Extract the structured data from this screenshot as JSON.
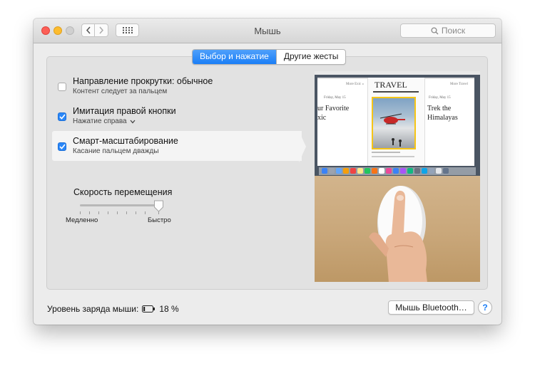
{
  "window": {
    "title": "Мышь"
  },
  "toolbar": {
    "search_placeholder": "Поиск",
    "back_icon": "chevron-left-icon",
    "forward_icon": "chevron-right-icon",
    "grid_icon": "grid-icon"
  },
  "tabs": [
    {
      "label": "Выбор и нажатие",
      "active": true
    },
    {
      "label": "Другие жесты",
      "active": false
    }
  ],
  "options": [
    {
      "title": "Направление прокрутки: обычное",
      "subtitle": "Контент следует за пальцем",
      "checked": false,
      "has_dropdown": false,
      "selected": false
    },
    {
      "title": "Имитация правой кнопки",
      "subtitle": "Нажатие справа",
      "checked": true,
      "has_dropdown": true,
      "selected": false
    },
    {
      "title": "Смарт-масштабирование",
      "subtitle": "Касание пальцем дважды",
      "checked": true,
      "has_dropdown": false,
      "selected": true
    }
  ],
  "tracking": {
    "label": "Скорость перемещения",
    "min_label": "Медленно",
    "max_label": "Быстро",
    "value_fraction": 0.94
  },
  "preview": {
    "left_date": "Friday, May 15",
    "left_more": "More Exic »",
    "left_headline_1": "ur Favorite",
    "left_headline_2": "xic",
    "center_title": "TRAVEL",
    "right_date": "Friday, May 15",
    "right_more": "More Travel",
    "right_headline_1": "Trek the",
    "right_headline_2": "Himalayas"
  },
  "footer": {
    "battery_label": "Уровень заряда мыши:",
    "battery_percent": "18 %",
    "battery_level": 0.18,
    "bluetooth_button": "Мышь Bluetooth…",
    "help_label": "?"
  },
  "colors": {
    "accent": "#1a7ef6",
    "close": "#fc5f57",
    "minimize": "#fdbc2e",
    "highlight": "#f5c518"
  }
}
